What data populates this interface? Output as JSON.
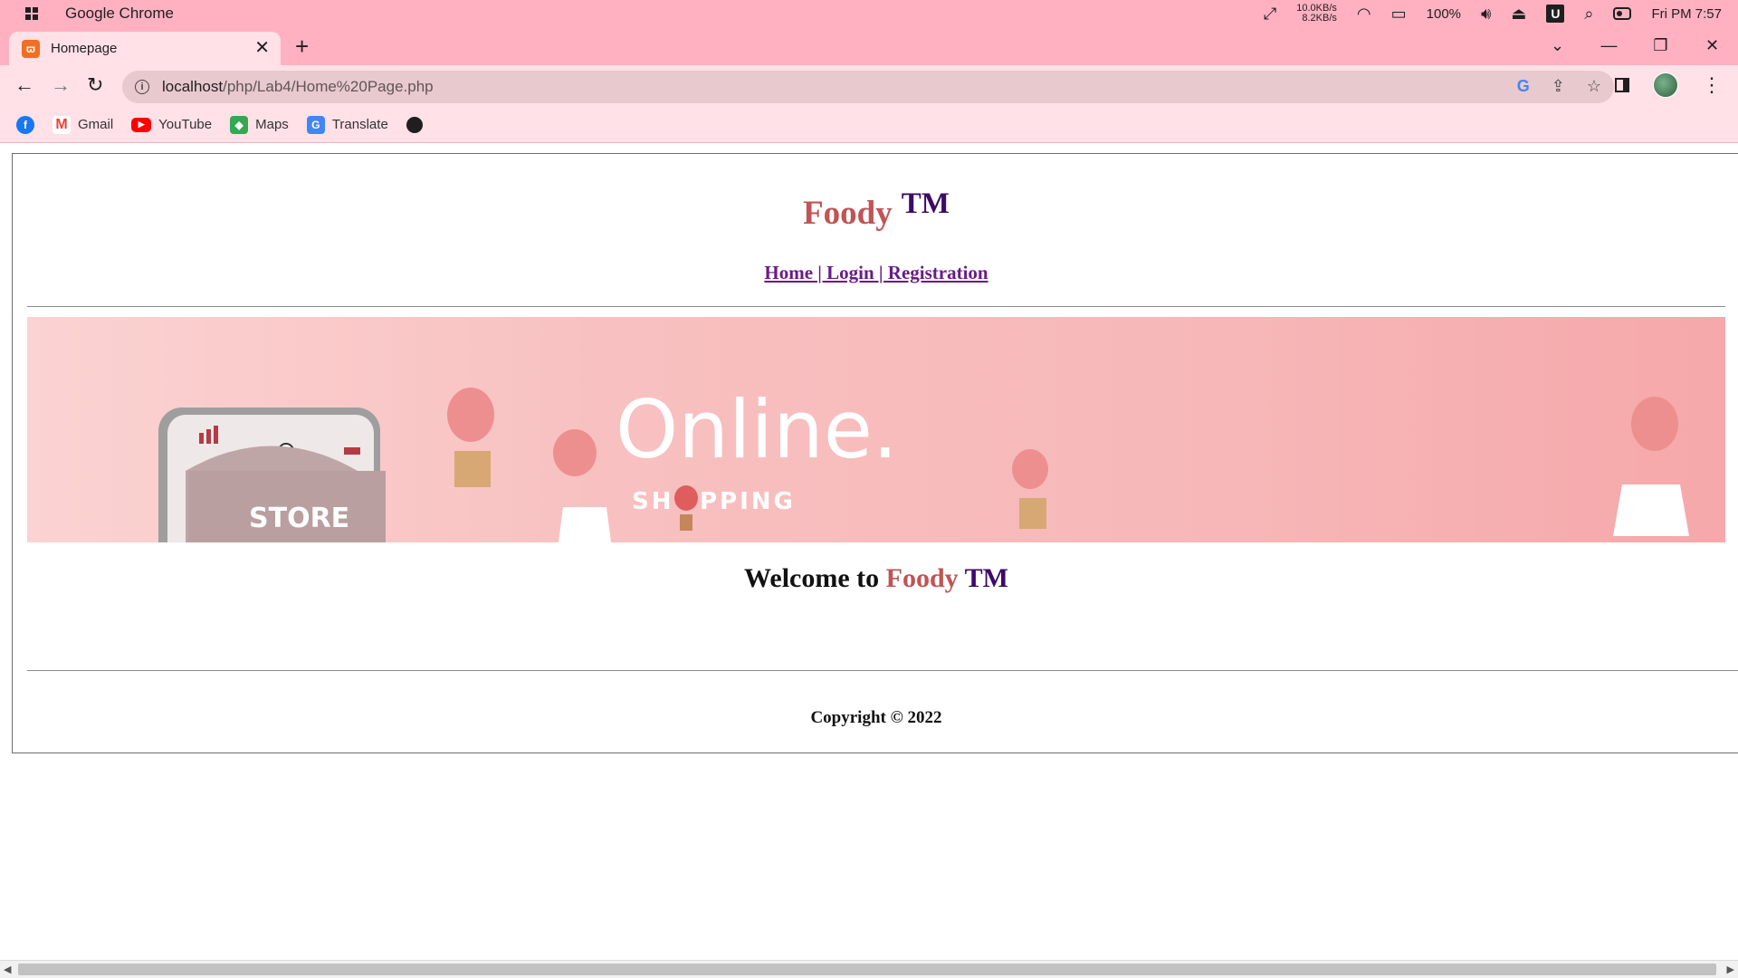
{
  "os_bar": {
    "app_title": "Google Chrome",
    "net_up": "10.0KB/s",
    "net_down": "8.2KB/s",
    "battery": "100%",
    "clock": "Fri PM 7:57"
  },
  "tab": {
    "title": "Homepage",
    "close": "✕",
    "new_tab": "+"
  },
  "window_controls": {
    "tab_search": "⌄",
    "minimize": "—",
    "restore": "❐",
    "close": "✕"
  },
  "toolbar": {
    "back": "←",
    "forward": "→",
    "reload": "↻",
    "url_host": "localhost",
    "url_path": "/php/Lab4/Home%20Page.php",
    "google_lens": "G",
    "share": "⇪",
    "star": "☆",
    "menu": "⋮"
  },
  "bookmarks": [
    {
      "label": "",
      "icon": "facebook-icon",
      "glyph": "f"
    },
    {
      "label": "Gmail",
      "icon": "gmail-icon",
      "glyph": "M"
    },
    {
      "label": "YouTube",
      "icon": "youtube-icon",
      "glyph": "▶"
    },
    {
      "label": "Maps",
      "icon": "maps-icon",
      "glyph": "◆"
    },
    {
      "label": "Translate",
      "icon": "translate-icon",
      "glyph": "G"
    }
  ],
  "site": {
    "brand": "Foody",
    "tm": "TM",
    "nav": "Home | Login | Registration",
    "welcome_prefix": "Welcome to ",
    "welcome_brand": "Foody",
    "welcome_tm": "TM",
    "copyright": "Copyright © 2022"
  },
  "banner": {
    "headline": "Online.",
    "subline_a": "SH",
    "subline_b": "PPING",
    "store_label": "STORE"
  },
  "colors": {
    "chrome_frame": "#ffb1c1",
    "chrome_toolbar": "#ffe1e7",
    "brand_red": "#c05454",
    "brand_purple": "#3d0a67",
    "link_purple": "#6a1b87"
  }
}
